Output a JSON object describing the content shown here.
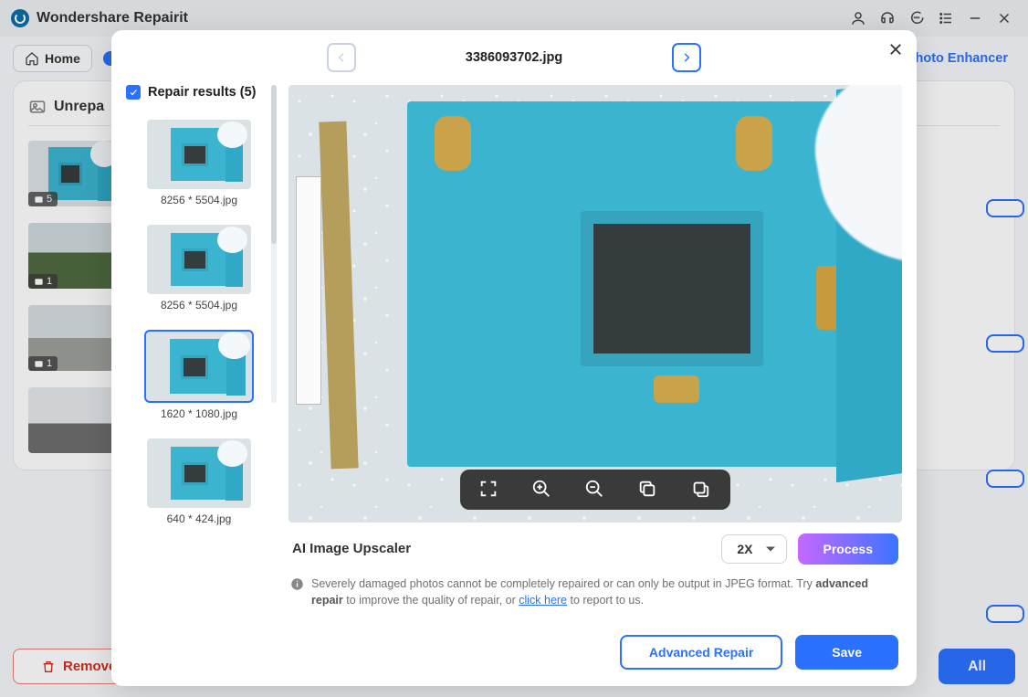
{
  "app": {
    "title": "Wondershare Repairit"
  },
  "toolbar": {
    "home": "Home",
    "photo_enhancer": "Photo Enhancer"
  },
  "panel": {
    "section_title": "Unrepa"
  },
  "side_thumbs": [
    {
      "badge": "5"
    },
    {
      "badge": "1"
    },
    {
      "badge": "1"
    }
  ],
  "bottom": {
    "remove": "Remove",
    "all": "All"
  },
  "modal": {
    "filename": "3386093702.jpg",
    "repair_results_label": "Repair results (5)",
    "thumbs": [
      {
        "caption": "8256 * 5504.jpg",
        "active": false
      },
      {
        "caption": "8256 * 5504.jpg",
        "active": false
      },
      {
        "caption": "1620 * 1080.jpg",
        "active": true
      },
      {
        "caption": "640 * 424.jpg",
        "active": false
      }
    ],
    "upscaler_label": "AI Image Upscaler",
    "upscale_value": "2X",
    "process": "Process",
    "info_pre": "Severely damaged photos cannot be completely repaired or can only be output in JPEG format. Try ",
    "info_bold": "advanced repair",
    "info_mid": " to improve the quality of repair, or ",
    "info_link": "click here",
    "info_post": " to report to us.",
    "advanced": "Advanced Repair",
    "save": "Save"
  }
}
